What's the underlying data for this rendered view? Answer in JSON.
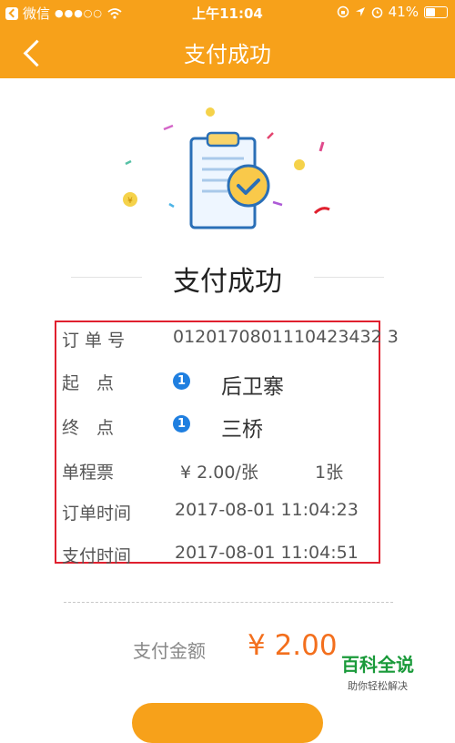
{
  "status_bar": {
    "carrier": "微信",
    "signal": "●●●○○",
    "time": "上午11:04",
    "battery_percent": "41%",
    "battery_level": 0.41
  },
  "nav": {
    "title": "支付成功"
  },
  "result": {
    "title": "支付成功"
  },
  "order": {
    "order_no_label": "订 单 号",
    "order_no": "0120170801110423432 3",
    "start_label": "起　点",
    "start_badge": "1",
    "start_station": "后卫寨",
    "end_label": "终　点",
    "end_badge": "1",
    "end_station": "三桥",
    "fare_label": "单程票",
    "fare_price": "¥ 2.00/张",
    "fare_qty": "1张",
    "order_time_label": "订单时间",
    "order_time": "2017-08-01 11:04:23",
    "pay_time_label": "支付时间",
    "pay_time": "2017-08-01 11:04:51"
  },
  "payment": {
    "label": "支付金额",
    "amount": "¥ 2.00"
  },
  "watermark": {
    "main": "百科全说",
    "sub": "助你轻松解决"
  },
  "colors": {
    "brand": "#f7a11a",
    "highlight_box": "#e0202e",
    "amount": "#f36f1d",
    "badge": "#1f7fe0"
  }
}
